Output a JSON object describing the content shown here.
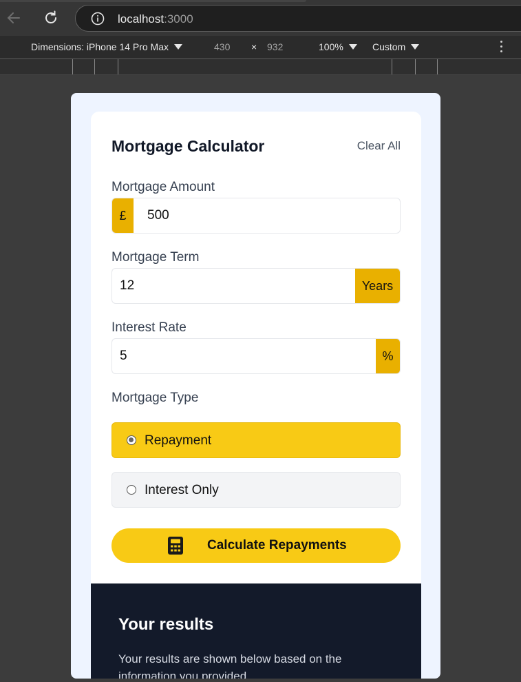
{
  "browser": {
    "url_host": "localhost",
    "url_port": ":3000"
  },
  "device_toolbar": {
    "dimensions_label": "Dimensions: iPhone 14 Pro Max",
    "width": "430",
    "times": "×",
    "height": "932",
    "zoom": "100%",
    "throttle": "Custom"
  },
  "app": {
    "title": "Mortgage Calculator",
    "clear_all": "Clear All",
    "amount": {
      "label": "Mortgage Amount",
      "prefix": "£",
      "value": "500"
    },
    "term": {
      "label": "Mortgage Term",
      "value": "12",
      "suffix": "Years"
    },
    "rate": {
      "label": "Interest Rate",
      "value": "5",
      "suffix": "%"
    },
    "type": {
      "label": "Mortgage Type",
      "options": [
        {
          "label": "Repayment",
          "selected": true
        },
        {
          "label": "Interest Only",
          "selected": false
        }
      ]
    },
    "calculate_label": "Calculate Repayments",
    "results": {
      "title": "Your results",
      "description": "Your results are shown below based on the information you provided."
    }
  },
  "colors": {
    "accent": "#f8ca15",
    "affix": "#e9b000",
    "results_bg": "#131a2a"
  }
}
